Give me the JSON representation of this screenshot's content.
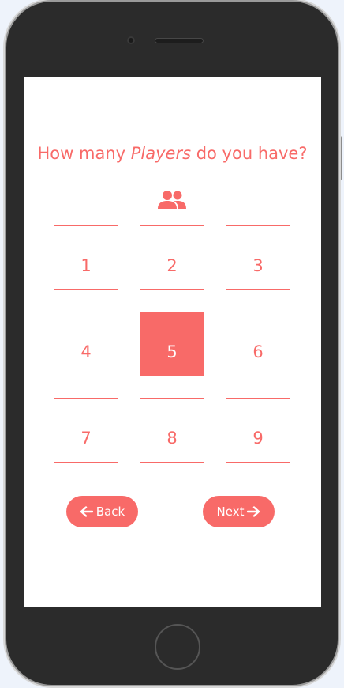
{
  "question": {
    "prefix": "How many ",
    "emphasis": "Players",
    "suffix": " do you have?"
  },
  "icons": {
    "players": "players-icon",
    "back_arrow": "arrow-left-icon",
    "next_arrow": "arrow-right-icon"
  },
  "options": [
    "1",
    "2",
    "3",
    "4",
    "5",
    "6",
    "7",
    "8",
    "9"
  ],
  "selected_option": "5",
  "buttons": {
    "back_label": "Back",
    "next_label": "Next"
  },
  "colors": {
    "accent": "#f86a68",
    "phone_body": "#2b2b2b",
    "screen_bg": "#ffffff"
  }
}
